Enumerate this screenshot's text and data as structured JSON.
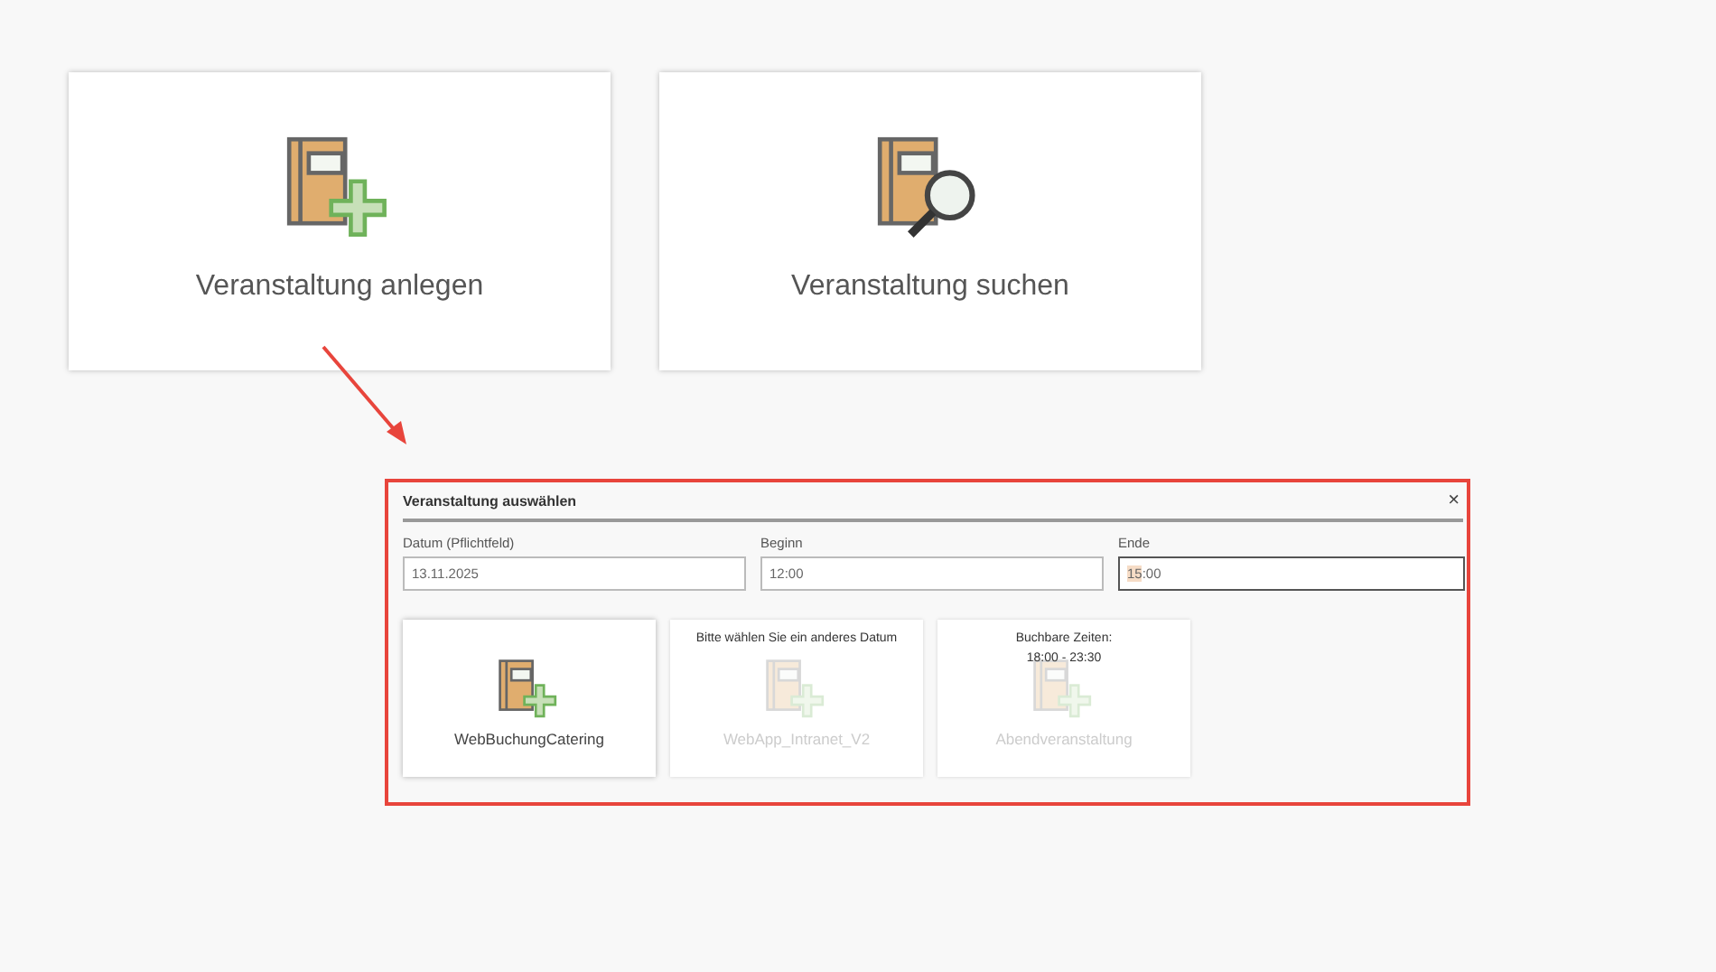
{
  "tiles": [
    {
      "label": "Veranstaltung anlegen",
      "kind": "add"
    },
    {
      "label": "Veranstaltung suchen",
      "kind": "search"
    }
  ],
  "dialog": {
    "title": "Veranstaltung auswählen",
    "close": "×",
    "fields": [
      {
        "label": "Datum (Pflichtfeld)",
        "value": "13.11.2025",
        "focused": false
      },
      {
        "label": "Beginn",
        "value": "12:00",
        "focused": false
      },
      {
        "label": "Ende",
        "value": "15:00",
        "focused": true
      }
    ],
    "events": [
      {
        "name": "WebBuchungCatering",
        "disabled": false
      },
      {
        "name": "WebApp_Intranet_V2",
        "disabled": true,
        "notes": [
          "Bitte wählen Sie ein anderes Datum"
        ]
      },
      {
        "name": "Abendveranstaltung",
        "disabled": true,
        "notes": [
          "Buchbare Zeiten:",
          "18:00 - 23:30"
        ]
      }
    ]
  }
}
